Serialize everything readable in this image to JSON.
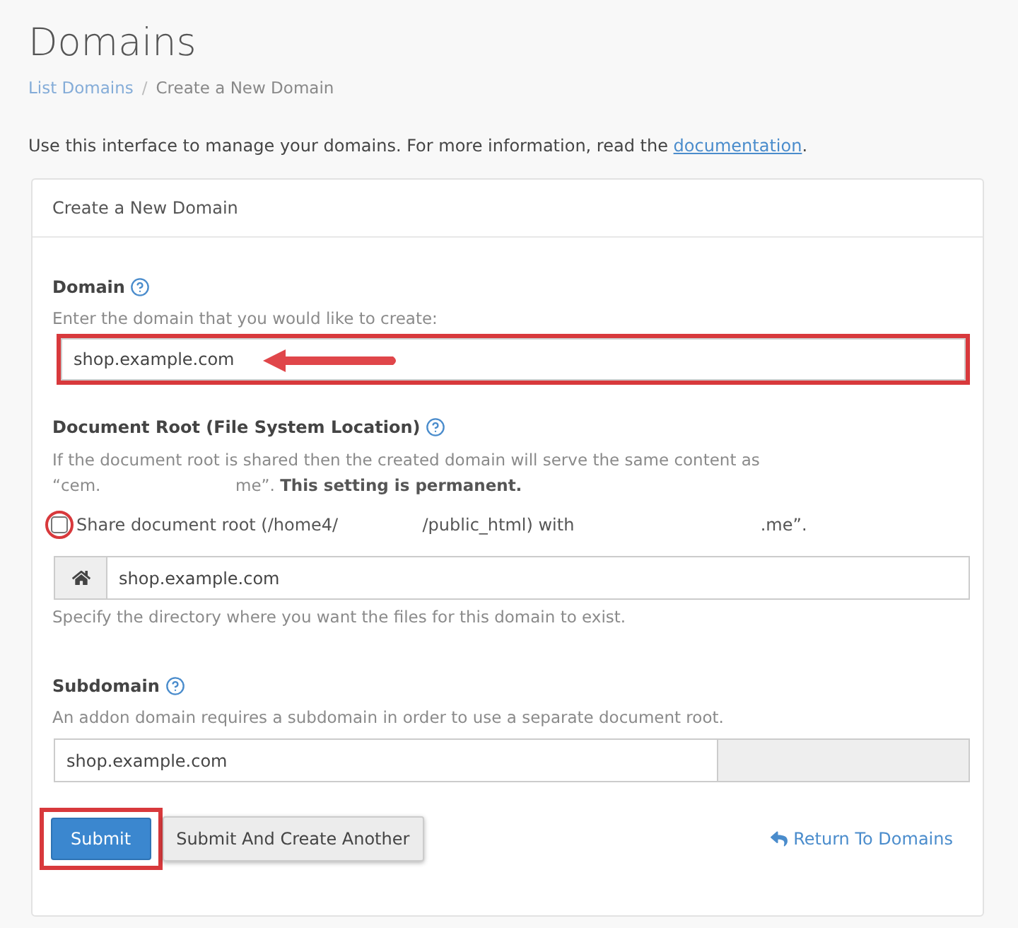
{
  "page": {
    "title": "Domains"
  },
  "breadcrumb": {
    "separator": "/",
    "items": [
      {
        "label": "List Domains",
        "kind": "link"
      },
      {
        "label": "Create a New Domain",
        "kind": "current"
      }
    ]
  },
  "intro": {
    "text": "Use this interface to manage your domains. For more information, read the",
    "link": "documentation",
    "end": "."
  },
  "card": {
    "title": "Create a New Domain"
  },
  "domain": {
    "label": "Domain",
    "hint": "Enter the domain that you would like to create:",
    "value": "shop.example.com",
    "highlighted": true,
    "arrow": true
  },
  "document_root": {
    "label": "Document Root (File System Location)",
    "description": [
      "If the document root is shared then the created domain will serve the same content as",
      "“cem.",
      "me”. **This setting is permanent.**"
    ],
    "share_label": [
      "Share document root (/home4/",
      "/public_html) with",
      ".me”."
    ],
    "share_checked": false,
    "share_highlighted": true,
    "value": "shop.example.com",
    "help": "Specify the directory where you want the files for this domain to exist."
  },
  "subdomain": {
    "label": "Subdomain",
    "hint": "An addon domain requires a subdomain in order to use a separate document root.",
    "value": "shop.example.com"
  },
  "actions": {
    "buttons": [
      {
        "label": "Submit",
        "kind": "primary",
        "highlighted": true
      },
      {
        "label": "Submit And Create Another",
        "kind": "default",
        "highlighted": false
      }
    ],
    "return_link": "Return To Domains"
  }
}
